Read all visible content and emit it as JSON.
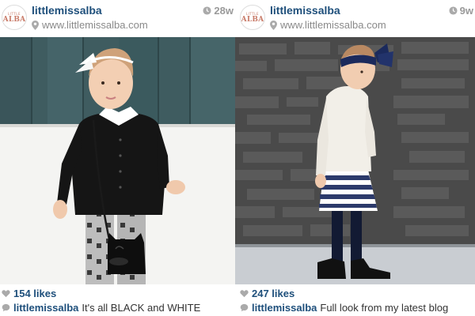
{
  "posts": [
    {
      "avatar": {
        "line1": "LITTLE",
        "line2": "ALBA"
      },
      "username": "littlemissalba",
      "website": "www.littlemissalba.com",
      "timestamp": "28w",
      "likes": "154 likes",
      "caption_user": "littlemissalba",
      "caption_text": "It's all BLACK and WHITE"
    },
    {
      "avatar": {
        "line1": "LITTLE",
        "line2": "ALBA"
      },
      "username": "littlemissalba",
      "website": "www.littlemissalba.com",
      "timestamp": "9w",
      "likes": "247 likes",
      "caption_user": "littlemissalba",
      "caption_text": "Full look from my latest blog"
    }
  ],
  "colors": {
    "link": "#1e4f7b",
    "meta": "#9a9a9a",
    "avatar_brand": "#c97c6a"
  },
  "icons": {
    "location": "location-pin-icon",
    "time": "clock-icon",
    "likes": "heart-icon",
    "comment": "comment-bubble-icon"
  }
}
